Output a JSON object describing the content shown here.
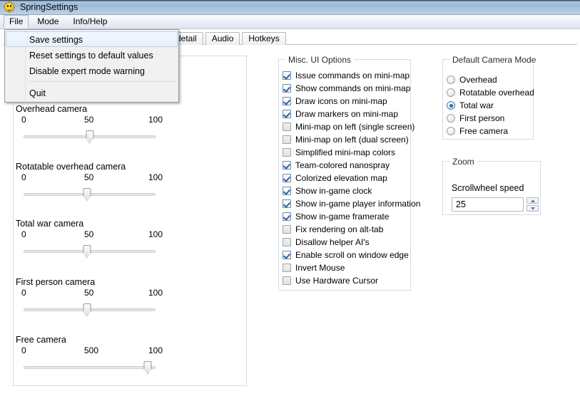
{
  "window": {
    "title": "SpringSettings",
    "icon": "sun-smiley-icon"
  },
  "menubar": {
    "items": [
      {
        "label": "File",
        "open": true
      },
      {
        "label": "Mode",
        "open": false
      },
      {
        "label": "Info/Help",
        "open": false
      }
    ]
  },
  "file_menu": {
    "items": [
      {
        "label": "Save settings",
        "selected": true
      },
      {
        "label": "Reset settings to default values",
        "selected": false
      },
      {
        "label": "Disable expert mode warning",
        "selected": false
      },
      {
        "label": "Quit",
        "selected": false
      }
    ]
  },
  "tabs": [
    {
      "label": "detail"
    },
    {
      "label": "Audio"
    },
    {
      "label": "Hotkeys"
    }
  ],
  "camera_sliders": {
    "items": [
      {
        "label": "Overhead camera",
        "tick_min": "0",
        "tick_mid": "50",
        "tick_max": "100",
        "value_pct": 50
      },
      {
        "label": "Rotatable overhead camera",
        "tick_min": "0",
        "tick_mid": "50",
        "tick_max": "100",
        "value_pct": 48
      },
      {
        "label": "Total war camera",
        "tick_min": "0",
        "tick_mid": "50",
        "tick_max": "100",
        "value_pct": 48
      },
      {
        "label": "First person camera",
        "tick_min": "0",
        "tick_mid": "50",
        "tick_max": "100",
        "value_pct": 48
      },
      {
        "label": "Free camera",
        "tick_min": "0",
        "tick_mid": "500",
        "tick_max": "100",
        "value_pct": 94
      }
    ]
  },
  "misc_ui_options": {
    "title": "Misc. UI Options",
    "items": [
      {
        "label": "Issue commands on mini-map",
        "checked": true
      },
      {
        "label": "Show commands on mini-map",
        "checked": true
      },
      {
        "label": "Draw icons on mini-map",
        "checked": true
      },
      {
        "label": "Draw markers on mini-map",
        "checked": true
      },
      {
        "label": "Mini-map on left (single screen)",
        "checked": false
      },
      {
        "label": "Mini-map on left (dual screen)",
        "checked": false
      },
      {
        "label": "Simplified mini-map colors",
        "checked": false
      },
      {
        "label": "Team-colored nanospray",
        "checked": true
      },
      {
        "label": "Colorized elevation map",
        "checked": true
      },
      {
        "label": "Show in-game clock",
        "checked": true
      },
      {
        "label": "Show in-game player information",
        "checked": true
      },
      {
        "label": "Show in-game framerate",
        "checked": true
      },
      {
        "label": "Fix rendering on alt-tab",
        "checked": false
      },
      {
        "label": "Disallow helper AI's",
        "checked": false
      },
      {
        "label": "Enable scroll on window edge",
        "checked": true
      },
      {
        "label": "Invert Mouse",
        "checked": false
      },
      {
        "label": "Use Hardware Cursor",
        "checked": false
      }
    ]
  },
  "default_camera_mode": {
    "title": "Default Camera Mode",
    "options": [
      {
        "label": "Overhead",
        "selected": false
      },
      {
        "label": "Rotatable overhead",
        "selected": false
      },
      {
        "label": "Total war",
        "selected": true
      },
      {
        "label": "First person",
        "selected": false
      },
      {
        "label": "Free camera",
        "selected": false
      }
    ]
  },
  "zoom_group": {
    "title": "Zoom",
    "scrollwheel_label": "Scrollwheel speed",
    "scrollwheel_value": "25"
  },
  "colors": {
    "titlebar_top": "#3c4f63",
    "titlebar_blue": "#9dbad6",
    "accent_blue": "#1d6fc4",
    "groupbox_border": "#d2dbe4",
    "menu_bg": "#f1f1f1"
  }
}
